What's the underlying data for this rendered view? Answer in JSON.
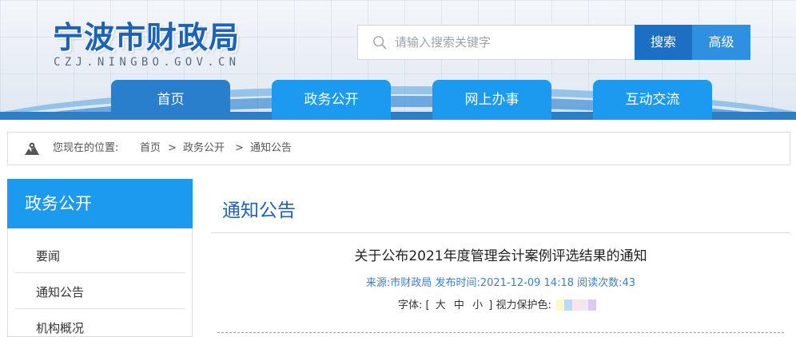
{
  "header": {
    "site_title": "宁波市财政局",
    "site_domain": "CZJ.NINGBO.GOV.CN",
    "search": {
      "placeholder": "请输入搜索关键字",
      "search_label": "搜索",
      "advanced_label": "高级",
      "icon": "search-icon"
    },
    "nav": [
      {
        "label": "首页",
        "active": true
      },
      {
        "label": "政务公开",
        "active": false
      },
      {
        "label": "网上办事",
        "active": false
      },
      {
        "label": "互动交流",
        "active": false
      }
    ]
  },
  "breadcrumb": {
    "icon": "location-map-icon",
    "prefix": "您现在的位置:",
    "items": [
      "首页",
      "政务公开",
      "通知公告"
    ],
    "separator": ">"
  },
  "sidebar": {
    "title": "政务公开",
    "items": [
      {
        "label": "要闻"
      },
      {
        "label": "通知公告"
      },
      {
        "label": "机构概况"
      }
    ]
  },
  "main": {
    "section_title": "通知公告",
    "article": {
      "title": "关于公布2021年度管理会计案例评选结果的通知",
      "source_label": "来源:",
      "source": "市财政局",
      "published_label": "发布时间:",
      "published": "2021-12-09 14:18",
      "views_label": "阅读次数:",
      "views": "43"
    },
    "tools": {
      "font_label": "字体:",
      "bracket_open": "[",
      "sizes": [
        "大",
        "中",
        "小"
      ],
      "bracket_close": "]",
      "eye_care_label": "视力保护色:",
      "eye_care_colors": [
        "#fafbc4",
        "#b8ddf2",
        "#fde4ea",
        "#f0e6f5",
        "#dccbf0"
      ]
    }
  },
  "colors": {
    "brand_blue": "#1a63b6",
    "nav_blue": "#1c9af0",
    "nav_active": "#2a7fcc",
    "search_btn": "#1d6fc4",
    "advanced_btn": "#2f8fe0"
  }
}
